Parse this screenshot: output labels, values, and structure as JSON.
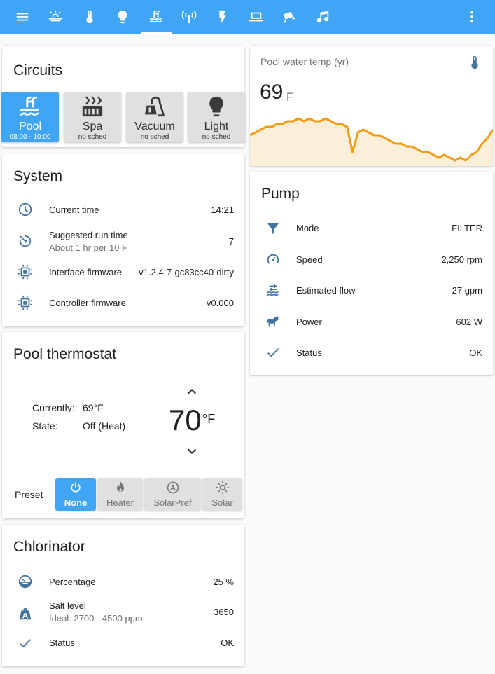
{
  "topbar": {
    "accent": "#41a5f5",
    "tabs": [
      "menu-icon",
      "weather-icon",
      "thermometer-icon",
      "lightbulb-icon",
      "pool-icon",
      "antenna-icon",
      "lightning-icon",
      "laptop-icon",
      "camera-icon",
      "music-icon",
      "more-icon"
    ]
  },
  "circuits": {
    "title": "Circuits",
    "buttons": [
      {
        "name": "Pool",
        "schedule": "08:00 - 10:00",
        "on": true
      },
      {
        "name": "Spa",
        "schedule": "no sched",
        "on": false
      },
      {
        "name": "Vacuum",
        "schedule": "no sched",
        "on": false
      },
      {
        "name": "Light",
        "schedule": "no sched",
        "on": false
      }
    ]
  },
  "system": {
    "title": "System",
    "rows": [
      {
        "icon": "clock-icon",
        "label": "Current time",
        "value": "14:21"
      },
      {
        "icon": "timer-icon",
        "label": "Suggested run time",
        "sub": "About 1 hr per 10 F",
        "value": "7"
      },
      {
        "icon": "chip-icon",
        "label": "Interface firmware",
        "value": "v1.2.4-7-gc83cc40-dirty"
      },
      {
        "icon": "chip-icon",
        "label": "Controller firmware",
        "value": "v0.000"
      }
    ]
  },
  "thermostat": {
    "title": "Pool thermostat",
    "currently_label": "Currently:",
    "currently_value": "69°F",
    "state_label": "State:",
    "state_value": "Off (Heat)",
    "target": "70",
    "unit": "°F",
    "preset_label": "Preset",
    "presets": [
      {
        "name": "None",
        "icon": "power-icon",
        "on": true
      },
      {
        "name": "Heater",
        "icon": "fire-icon",
        "on": false
      },
      {
        "name": "SolarPref",
        "icon": "solar-pref-icon",
        "on": false
      },
      {
        "name": "Solar",
        "icon": "sun-icon",
        "on": false
      }
    ]
  },
  "chlorinator": {
    "title": "Chlorinator",
    "rows": [
      {
        "icon": "gauge-icon",
        "label": "Percentage",
        "value": "25 %"
      },
      {
        "icon": "weight-icon",
        "label": "Salt level",
        "sub": "Ideal: 2700 - 4500 ppm",
        "value": "3650"
      },
      {
        "icon": "check-icon",
        "label": "Status",
        "value": "OK"
      }
    ]
  },
  "water_temp": {
    "title": "Pool water temp (yr)",
    "value": "69",
    "unit": "F",
    "line_color": "#f39c12",
    "fill_color": "#fcefd9",
    "series": [
      63,
      64,
      65,
      66,
      66,
      67,
      67,
      68,
      68,
      69,
      68,
      69,
      68,
      68,
      69,
      68,
      67,
      67,
      66,
      57,
      64,
      65,
      64,
      63,
      63,
      62,
      61,
      60,
      60,
      59,
      59,
      58,
      57,
      57,
      56,
      55,
      56,
      55,
      54,
      55,
      54,
      56,
      57,
      60,
      62,
      65
    ]
  },
  "pump": {
    "title": "Pump",
    "rows": [
      {
        "icon": "filter-icon",
        "label": "Mode",
        "value": "FILTER"
      },
      {
        "icon": "speedometer-icon",
        "label": "Speed",
        "value": "2,250 rpm"
      },
      {
        "icon": "flow-icon",
        "label": "Estimated flow",
        "value": "27 gpm"
      },
      {
        "icon": "horse-icon",
        "label": "Power",
        "value": "602 W"
      },
      {
        "icon": "check-icon",
        "label": "Status",
        "value": "OK"
      }
    ]
  }
}
